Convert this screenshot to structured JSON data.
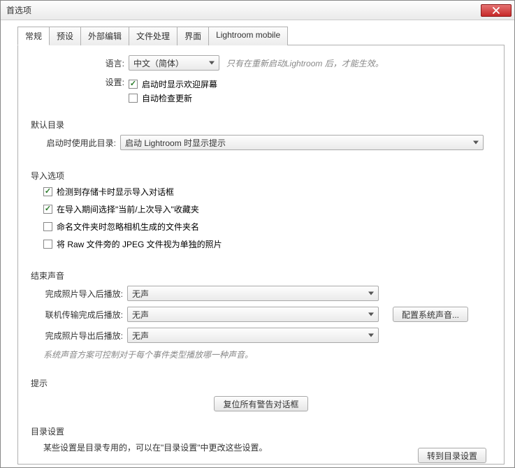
{
  "window": {
    "title": "首选项"
  },
  "tabs": [
    {
      "label": "常规"
    },
    {
      "label": "预设"
    },
    {
      "label": "外部编辑"
    },
    {
      "label": "文件处理"
    },
    {
      "label": "界面"
    },
    {
      "label": "Lightroom mobile"
    }
  ],
  "general": {
    "language_label": "语言:",
    "language_value": "中文（简体）",
    "language_hint": "只有在重新启动Lightroom 后，才能生效。",
    "settings_label": "设置:",
    "cb_show_splash": "启动时显示欢迎屏幕",
    "cb_auto_update": "自动检查更新"
  },
  "default_catalog": {
    "title": "默认目录",
    "row_label": "启动时使用此目录:",
    "value": "启动 Lightroom 时显示提示"
  },
  "import_options": {
    "title": "导入选项",
    "cb_detect_card": "检测到存储卡时显示导入对话框",
    "cb_select_collection": "在导入期间选择\"当前/上次导入\"收藏夹",
    "cb_ignore_camera_folder": "命名文件夹时忽略相机生成的文件夹名",
    "cb_treat_jpeg_separate": "将 Raw 文件旁的 JPEG 文件视为单独的照片"
  },
  "sounds": {
    "title": "结束声音",
    "row1_label": "完成照片导入后播放:",
    "row2_label": "联机传输完成后播放:",
    "row3_label": "完成照片导出后播放:",
    "value_none": "无声",
    "configure_button": "配置系统声音...",
    "note": "系统声音方案可控制对于每个事件类型播放哪一种声音。"
  },
  "prompts": {
    "title": "提示",
    "reset_button": "复位所有警告对话框"
  },
  "catalog_settings": {
    "title": "目录设置",
    "note": "某些设置是目录专用的，可以在\"目录设置\"中更改这些设置。",
    "goto_button": "转到目录设置"
  }
}
